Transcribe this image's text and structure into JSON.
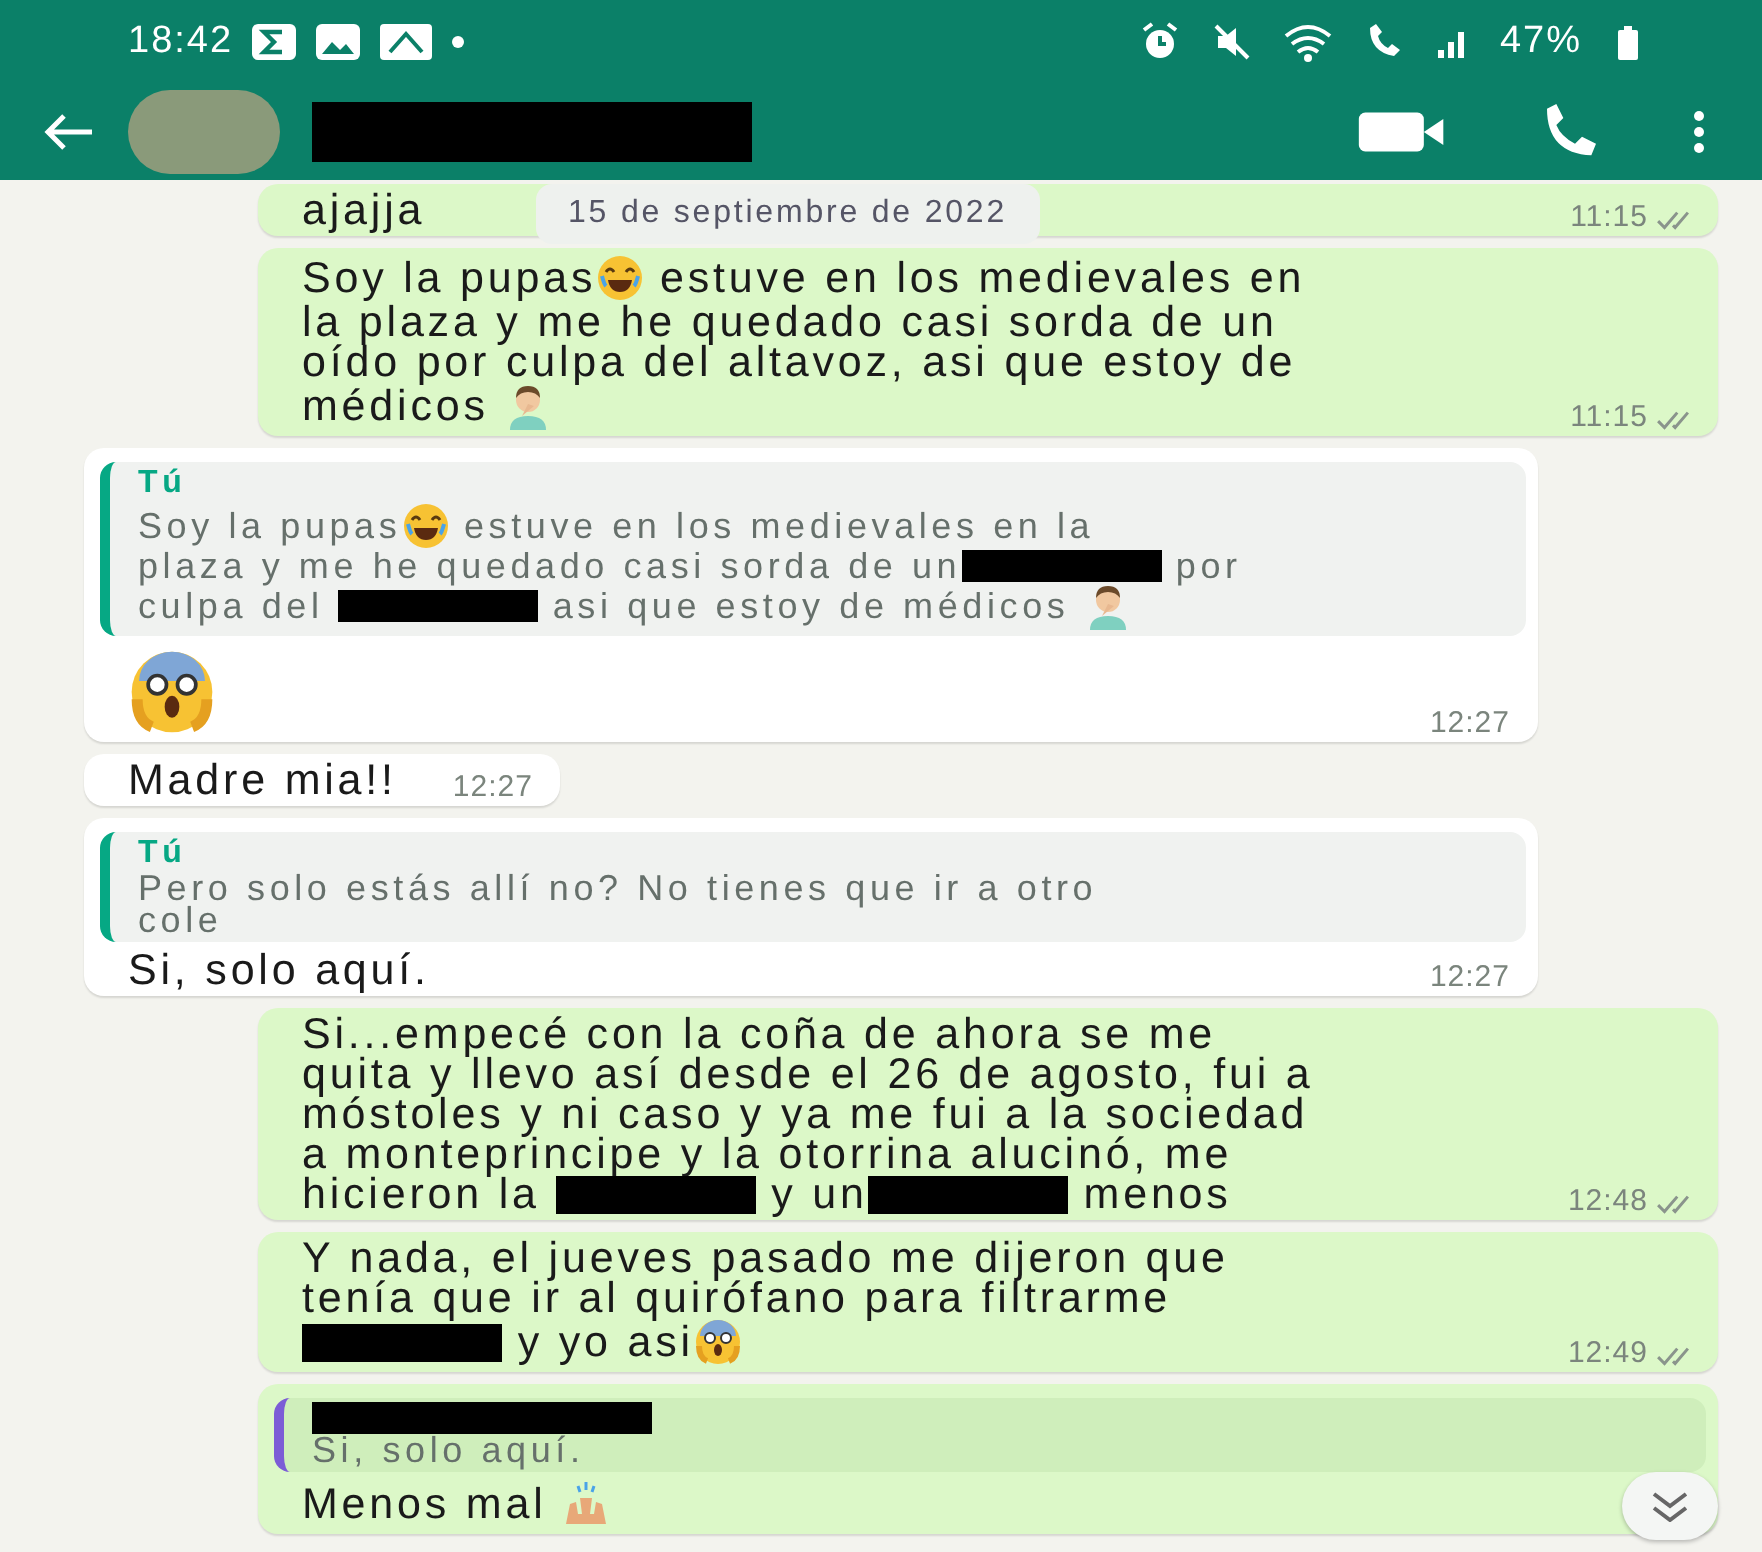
{
  "status_bar": {
    "time": "18:42",
    "battery": "47%"
  },
  "header": {
    "contact_redacted": true
  },
  "date_chip": "15 de septiembre de 2022",
  "messages": [
    {
      "outgoing": true,
      "read": false,
      "time": "11:15",
      "lines": [
        [
          {
            "kind": "text",
            "text": "ajajja"
          }
        ]
      ]
    },
    {
      "outgoing": true,
      "read": false,
      "time": "11:15",
      "lines": [
        [
          {
            "kind": "text",
            "text": "Soy la pupas"
          },
          {
            "kind": "laughing"
          },
          {
            "kind": "text",
            "text": " estuve en los medievales en"
          }
        ],
        [
          {
            "kind": "text",
            "text": "la plaza y me he quedado casi sorda de un"
          }
        ],
        [
          {
            "kind": "text",
            "text": "oído por culpa del altavoz, asi que estoy de"
          }
        ],
        [
          {
            "kind": "text",
            "text": "médicos "
          },
          {
            "kind": "facepalm"
          }
        ]
      ]
    },
    {
      "outgoing": false,
      "time": "12:27",
      "quote": {
        "color": "#06a884",
        "author": [
          {
            "kind": "text",
            "text": "Tú"
          }
        ],
        "lines": [
          [
            {
              "kind": "text",
              "text": "Soy la pupas"
            },
            {
              "kind": "laughing"
            },
            {
              "kind": "text",
              "text": " estuve en los medievales en la"
            }
          ],
          [
            {
              "kind": "text",
              "text": "plaza y me he quedado casi sorda de un"
            },
            {
              "kind": "redacted"
            },
            {
              "kind": "text",
              "text": " por"
            }
          ],
          [
            {
              "kind": "text",
              "text": "culpa del "
            },
            {
              "kind": "redacted"
            },
            {
              "kind": "text",
              "text": " asi que estoy de médicos "
            },
            {
              "kind": "facepalm"
            }
          ]
        ]
      },
      "lines": [
        [
          {
            "kind": "shocked"
          }
        ]
      ]
    },
    {
      "outgoing": false,
      "time": "12:27",
      "lines": [
        [
          {
            "kind": "text",
            "text": "Madre mia!!"
          }
        ]
      ]
    },
    {
      "outgoing": false,
      "time": "12:27",
      "quote": {
        "color": "#06a884",
        "author": [
          {
            "kind": "text",
            "text": "Tú"
          }
        ],
        "lines": [
          [
            {
              "kind": "text",
              "text": "Pero solo estás allí no? No tienes que ir a otro"
            }
          ],
          [
            {
              "kind": "text",
              "text": "cole"
            }
          ]
        ]
      },
      "lines": [
        [
          {
            "kind": "text",
            "text": "Si, solo aquí."
          }
        ]
      ]
    },
    {
      "outgoing": true,
      "read": false,
      "time": "12:48",
      "lines": [
        [
          {
            "kind": "text",
            "text": "Si...empecé con la coña de ahora se me"
          }
        ],
        [
          {
            "kind": "text",
            "text": "quita y llevo así desde el 26 de agosto, fui a"
          }
        ],
        [
          {
            "kind": "text",
            "text": "móstoles y ni caso y ya me fui a la sociedad"
          }
        ],
        [
          {
            "kind": "text",
            "text": "a monteprincipe y la otorrina alucinó, me"
          }
        ],
        [
          {
            "kind": "text",
            "text": "hicieron la "
          },
          {
            "kind": "redacted"
          },
          {
            "kind": "text",
            "text": " y un"
          },
          {
            "kind": "redacted"
          },
          {
            "kind": "text",
            "text": " menos"
          }
        ]
      ]
    },
    {
      "outgoing": true,
      "read": false,
      "time": "12:49",
      "lines": [
        [
          {
            "kind": "text",
            "text": "Y nada, el jueves pasado me dijeron que"
          }
        ],
        [
          {
            "kind": "text",
            "text": "tenía que ir al quirófano para filtrarme"
          }
        ],
        [
          {
            "kind": "redacted"
          },
          {
            "kind": "text",
            "text": " y yo asi"
          },
          {
            "kind": "shocked"
          }
        ]
      ]
    },
    {
      "outgoing": true,
      "quote": {
        "color": "#7c5cd6",
        "author": [
          {
            "kind": "redacted"
          }
        ],
        "lines": [
          [
            {
              "kind": "text",
              "text": "Si, solo aquí."
            }
          ]
        ]
      },
      "lines": [
        [
          {
            "kind": "text",
            "text": "Menos mal "
          },
          {
            "kind": "raised-hands"
          }
        ]
      ]
    }
  ]
}
